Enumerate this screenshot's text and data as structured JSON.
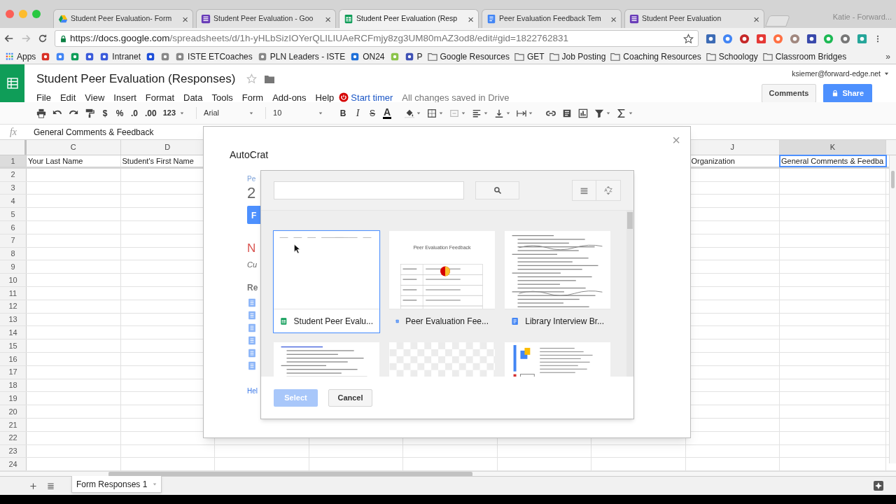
{
  "browser": {
    "tabs": [
      {
        "title": "Student Peer Evaluation- Form",
        "kind": "drive",
        "selected": false
      },
      {
        "title": "Student Peer Evaluation - Goo",
        "kind": "forms",
        "selected": false
      },
      {
        "title": "Student Peer Evaluation (Resp",
        "kind": "sheets",
        "selected": true
      },
      {
        "title": "Peer Evaluation Feedback Tem",
        "kind": "docs",
        "selected": false
      },
      {
        "title": "Student Peer Evaluation",
        "kind": "forms",
        "selected": false
      }
    ],
    "close_glyph": "×",
    "profile": "Katie - Forward...",
    "url_host": "https://docs.google.com",
    "url_path": "/spreadsheets/d/1h-yHLbSizIOYerQLILIUAeRCFmjy8zg3UM80mAZ3od8/edit#gid=1822762831",
    "bookmarks": [
      {
        "kind": "apps",
        "label": "Apps"
      },
      {
        "kind": "site",
        "color": "#d93025"
      },
      {
        "kind": "site",
        "color": "#4285f4"
      },
      {
        "kind": "site",
        "color": "#0f9d58"
      },
      {
        "kind": "site",
        "color": "#3b5bdb"
      },
      {
        "kind": "site",
        "color": "#3b5bdb",
        "label": "Intranet"
      },
      {
        "kind": "site",
        "color": "#1d4ed8"
      },
      {
        "kind": "site",
        "color": "#888888"
      },
      {
        "kind": "site",
        "color": "#888888",
        "label": "ISTE ETCoaches"
      },
      {
        "kind": "site",
        "color": "#888888",
        "label": "PLN Leaders - ISTE"
      },
      {
        "kind": "site",
        "color": "#1e6fd9",
        "label": "ON24"
      },
      {
        "kind": "site",
        "color": "#8bc34a"
      },
      {
        "kind": "site",
        "color": "#3f51b5",
        "label": "P"
      },
      {
        "kind": "folder",
        "label": "Google Resources"
      },
      {
        "kind": "folder",
        "label": "GET"
      },
      {
        "kind": "folder",
        "label": "Job Posting"
      },
      {
        "kind": "folder",
        "label": "Coaching Resources"
      },
      {
        "kind": "folder",
        "label": "Schoology"
      },
      {
        "kind": "folder",
        "label": "Classroom Bridges"
      }
    ],
    "more": "»"
  },
  "sheets": {
    "title": "Student Peer Evaluation (Responses)",
    "menus": [
      "File",
      "Edit",
      "View",
      "Insert",
      "Format",
      "Data",
      "Tools",
      "Form",
      "Add-ons",
      "Help"
    ],
    "timer": "Start timer",
    "save_status": "All changes saved in Drive",
    "account": "ksiemer@forward-edge.net",
    "comments_button": "Comments",
    "share_button": "Share",
    "toolbar": [
      {
        "kind": "print"
      },
      {
        "kind": "undo"
      },
      {
        "kind": "redo"
      },
      {
        "kind": "paint"
      },
      {
        "kind": "text",
        "label": "$"
      },
      {
        "kind": "text",
        "label": "%"
      },
      {
        "kind": "text",
        "label": ".0"
      },
      {
        "kind": "text",
        "label": ".00"
      },
      {
        "kind": "dropdown",
        "label": "123"
      },
      {
        "kind": "font-dropdown",
        "label": "Arial"
      },
      {
        "kind": "font-dropdown",
        "label": "10"
      },
      {
        "kind": "bold",
        "label": "B"
      },
      {
        "kind": "italic",
        "label": "I"
      },
      {
        "kind": "strike",
        "label": "S"
      },
      {
        "kind": "color",
        "label": "A"
      },
      {
        "kind": "fill"
      },
      {
        "kind": "borders"
      },
      {
        "kind": "merge"
      },
      {
        "kind": "align"
      },
      {
        "kind": "valign"
      },
      {
        "kind": "wrap"
      },
      {
        "kind": "link"
      },
      {
        "kind": "comment"
      },
      {
        "kind": "chart"
      },
      {
        "kind": "filter"
      },
      {
        "kind": "sigma"
      }
    ],
    "formula_label": "fx",
    "formula_value": "General Comments & Feedback",
    "columns_left": [
      {
        "letter": "C",
        "cell": "Your Last Name",
        "selected": false
      },
      {
        "letter": "D",
        "cell": "Student's First Name",
        "selected": false
      }
    ],
    "columns_right": [
      {
        "letter": "J",
        "cell": "Organization",
        "selected": false
      },
      {
        "letter": "K",
        "cell": "General Comments & Feedba",
        "selected": true
      }
    ],
    "rows": [
      "1",
      "2",
      "3",
      "4",
      "5",
      "6",
      "7",
      "8",
      "9",
      "10",
      "11",
      "12",
      "13",
      "14",
      "15",
      "16",
      "17",
      "18",
      "19",
      "20",
      "21",
      "22",
      "23",
      "24"
    ],
    "sheet_tabs": [
      {
        "label": "Form Responses 1",
        "selected": true
      }
    ]
  },
  "dialog": {
    "title": "AutoCrat",
    "close": "×",
    "behind": [
      {
        "kind": "caption",
        "text": "Pe"
      },
      {
        "kind": "number",
        "text": "2"
      },
      {
        "kind": "button",
        "text": "F"
      },
      {
        "kind": "alert",
        "text": "N"
      },
      {
        "kind": "note",
        "text": "Cu"
      },
      {
        "kind": "heading",
        "text": "Re"
      },
      {
        "kind": "doclist"
      },
      {
        "kind": "link",
        "text": "Hel"
      }
    ],
    "picker": {
      "files": [
        {
          "title": "Student Peer Evalu...",
          "kind": "sheet",
          "selected": true
        },
        {
          "title": "Peer Evaluation Fee...",
          "kind": "doc",
          "preview_title": "Peer Evaluation Feedback",
          "selected": false
        },
        {
          "title": "Library Interview Br...",
          "kind": "doc",
          "selected": false
        },
        {
          "selected": false
        },
        {
          "selected": false
        },
        {
          "selected": false
        }
      ],
      "select_button": {
        "label": "Select",
        "disabled": true
      },
      "cancel_button": {
        "label": "Cancel",
        "disabled": false
      }
    }
  }
}
